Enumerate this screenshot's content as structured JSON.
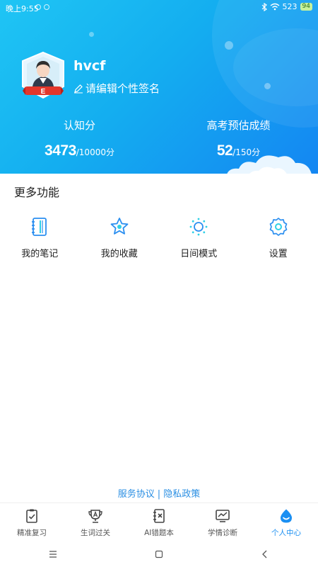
{
  "status_bar": {
    "time": "晚上9:55",
    "network": "523",
    "battery": "94"
  },
  "profile": {
    "username": "hvcf",
    "signature": "请编辑个性签名",
    "avatar_badge": "E"
  },
  "stats": [
    {
      "label": "认知分",
      "value": "3473",
      "unit": "/10000分"
    },
    {
      "label": "高考预估成绩",
      "value": "52",
      "unit": "/150分"
    }
  ],
  "more": {
    "title": "更多功能",
    "items": [
      {
        "label": "我的笔记",
        "icon": "notebook-icon"
      },
      {
        "label": "我的收藏",
        "icon": "star-icon"
      },
      {
        "label": "日间模式",
        "icon": "sun-icon"
      },
      {
        "label": "设置",
        "icon": "gear-icon"
      }
    ]
  },
  "links": {
    "terms": "服务协议",
    "separator": "|",
    "privacy": "隐私政策"
  },
  "tabs": [
    {
      "label": "精准复习",
      "icon": "clipboard-check-icon"
    },
    {
      "label": "生词过关",
      "icon": "trophy-a-icon"
    },
    {
      "label": "AI错题本",
      "icon": "mistake-book-icon"
    },
    {
      "label": "学情诊断",
      "icon": "chart-monitor-icon"
    },
    {
      "label": "个人中心",
      "icon": "person-drop-icon",
      "active": true
    }
  ],
  "colors": {
    "accent": "#1a8ff2",
    "header_start": "#1fc5f4",
    "header_end": "#1486f2",
    "link": "#2b8fe3"
  }
}
